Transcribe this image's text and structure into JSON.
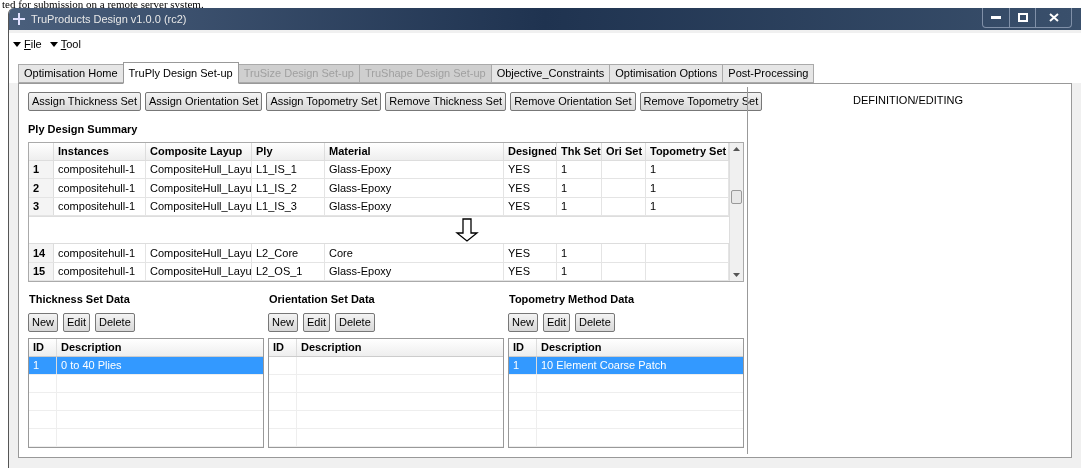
{
  "doc_caption": "ted for submission on a remote server system.",
  "window": {
    "title": "TruProducts Design v1.0.0 (rc2)"
  },
  "menu": [
    {
      "label": "File"
    },
    {
      "label": "Tool"
    }
  ],
  "tabs": [
    {
      "label": "Optimisation Home",
      "selected": false,
      "disabled": false
    },
    {
      "label": "TruPly Design Set-up",
      "selected": true,
      "disabled": false
    },
    {
      "label": "TruSize Design Set-up",
      "selected": false,
      "disabled": true
    },
    {
      "label": "TruShape Design Set-up",
      "selected": false,
      "disabled": true
    },
    {
      "label": "Objective_Constraints",
      "selected": false,
      "disabled": false
    },
    {
      "label": "Optimisation Options",
      "selected": false,
      "disabled": false
    },
    {
      "label": "Post-Processing",
      "selected": false,
      "disabled": false
    }
  ],
  "action_buttons": [
    "Assign Thickness Set",
    "Assign Orientation Set",
    "Assign Topometry Set",
    "Remove Thickness Set",
    "Remove Orientation Set",
    "Remove Topometry Set"
  ],
  "ply_summary": {
    "title": "Ply Design Summary",
    "columns": [
      "Instances",
      "Composite Layup",
      "Ply",
      "Material",
      "Designed",
      "Thk Set",
      "Ori Set",
      "Topometry Set"
    ],
    "rows_above_break": [
      {
        "index": "1",
        "cells": [
          "compositehull-1",
          "CompositeHull_Layu",
          "L1_IS_1",
          "Glass-Epoxy",
          "YES",
          "1",
          "",
          "1"
        ]
      },
      {
        "index": "2",
        "cells": [
          "compositehull-1",
          "CompositeHull_Layu",
          "L1_IS_2",
          "Glass-Epoxy",
          "YES",
          "1",
          "",
          "1"
        ]
      },
      {
        "index": "3",
        "cells": [
          "compositehull-1",
          "CompositeHull_Layu",
          "L1_IS_3",
          "Glass-Epoxy",
          "YES",
          "1",
          "",
          "1"
        ]
      }
    ],
    "rows_below_break": [
      {
        "index": "14",
        "cells": [
          "compositehull-1",
          "CompositeHull_Layu",
          "L2_Core",
          "Core",
          "YES",
          "1",
          "",
          ""
        ]
      },
      {
        "index": "15",
        "cells": [
          "compositehull-1",
          "CompositeHull_Layu",
          "L2_OS_1",
          "Glass-Epoxy",
          "YES",
          "1",
          "",
          ""
        ]
      }
    ]
  },
  "data_panels": [
    {
      "title": "Thickness Set Data",
      "buttons": [
        "New",
        "Edit",
        "Delete"
      ],
      "columns": [
        "ID",
        "Description"
      ],
      "rows": [
        {
          "id": "1",
          "description": "0 to 40 Plies",
          "selected": true
        }
      ]
    },
    {
      "title": "Orientation Set Data",
      "buttons": [
        "New",
        "Edit",
        "Delete"
      ],
      "columns": [
        "ID",
        "Description"
      ]
    },
    {
      "title": "Topometry Method Data",
      "buttons": [
        "New",
        "Edit",
        "Delete"
      ],
      "columns": [
        "ID",
        "Description"
      ],
      "rows": [
        {
          "id": "1",
          "description": "10 Element Coarse Patch",
          "selected": true
        }
      ]
    }
  ],
  "right_panel": {
    "title": "DEFINITION/EDITING"
  }
}
